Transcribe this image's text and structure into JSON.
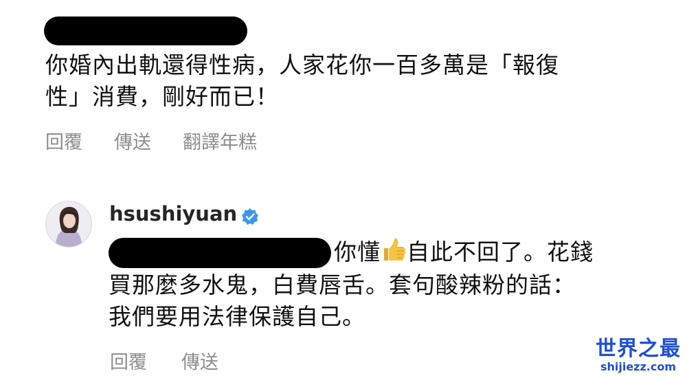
{
  "comment1": {
    "line1": "你婚內出軌還得性病，人家花你一百多萬是「報復",
    "line2": "性」消費，剛好而已！",
    "actions": {
      "reply": "回覆",
      "send": "傳送",
      "translate": "翻譯年糕"
    }
  },
  "reply": {
    "username": "hsushiyuan",
    "verified": true,
    "line1_a": "你懂",
    "emoji": "thumbs-up-icon",
    "line1_b": "自此不回了。花錢",
    "line2": "買那麼多水鬼，白費唇舌。套句酸辣粉的話：",
    "line3": "我們要用法律保護自己。",
    "actions": {
      "reply": "回覆",
      "send": "傳送"
    }
  },
  "watermark": {
    "title": "世界之最",
    "url": "shijiezz.com"
  },
  "colors": {
    "text": "#111111",
    "action_gray": "#8e8e8e",
    "verified_blue": "#3897f0",
    "watermark_blue": "#1f4fd6"
  }
}
